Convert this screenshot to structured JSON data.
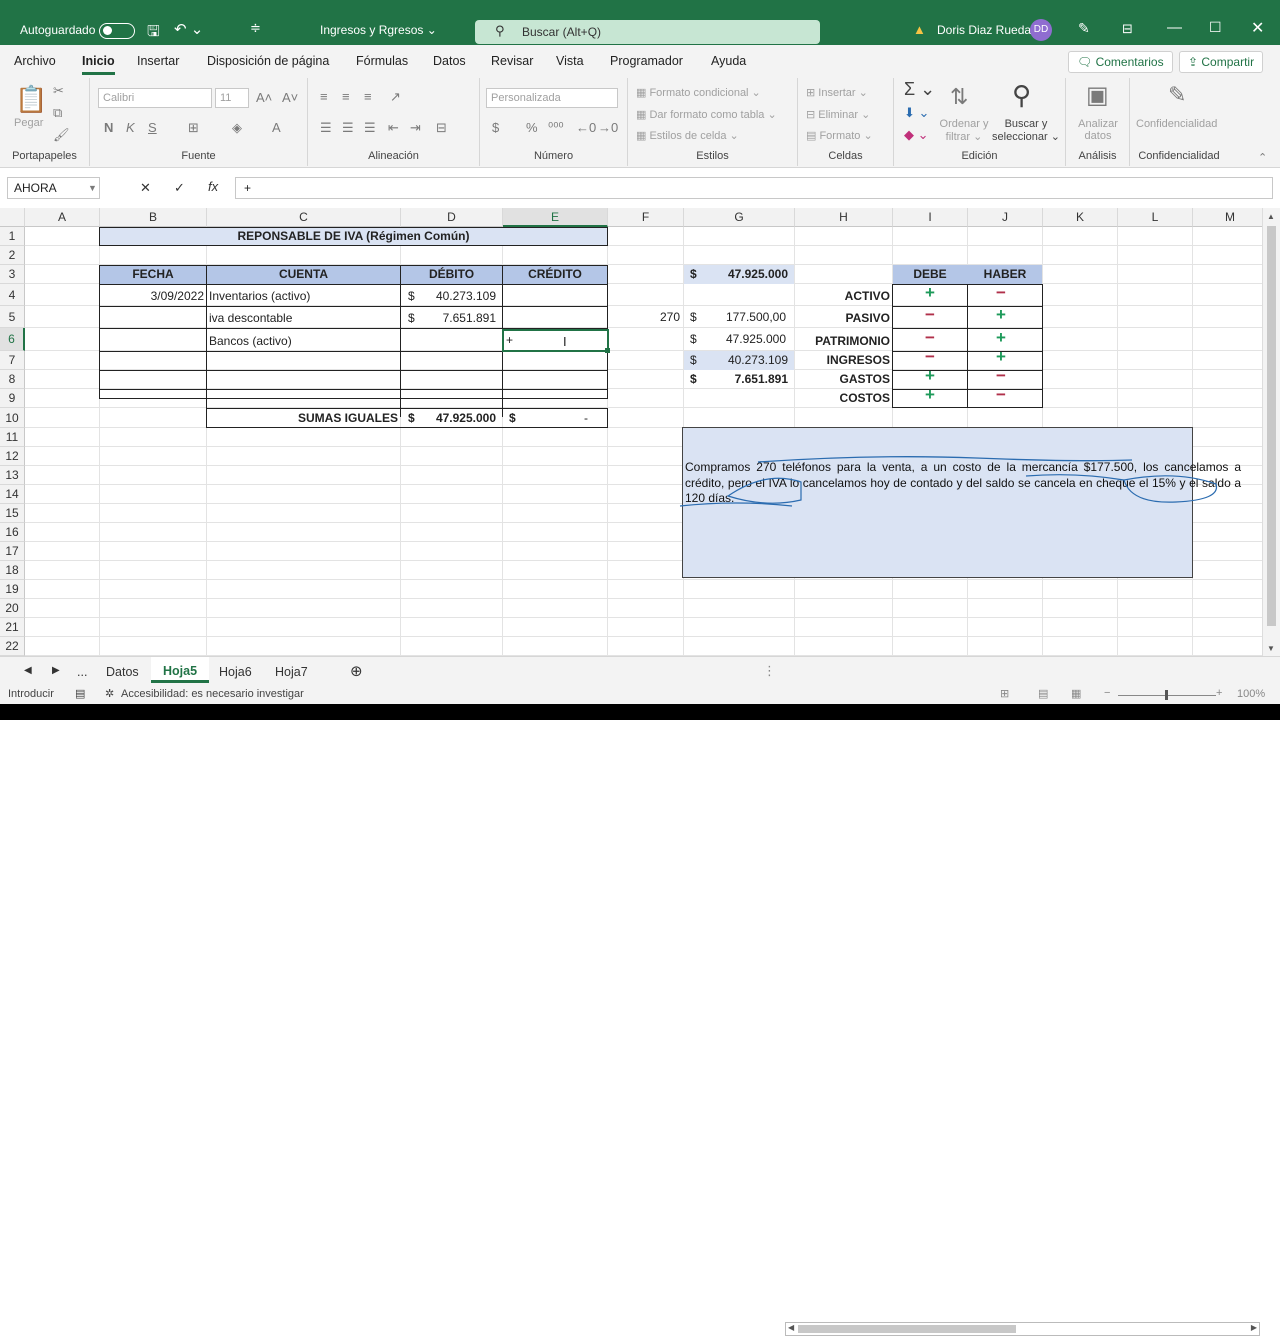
{
  "titlebar": {
    "autosave_label": "Autoguardado",
    "filename": "Ingresos y Rgresos ⌄",
    "search_placeholder": "Buscar (Alt+Q)",
    "user_name": "Doris Diaz Rueda",
    "user_initials": "DD"
  },
  "tabs": [
    "Archivo",
    "Inicio",
    "Insertar",
    "Disposición de página",
    "Fórmulas",
    "Datos",
    "Revisar",
    "Vista",
    "Programador",
    "Ayuda"
  ],
  "top_buttons": {
    "comments": "Comentarios",
    "share": "Compartir"
  },
  "ribbon": {
    "paste": "Pegar",
    "font_name": "Calibri",
    "font_size": "11",
    "number_format": "Personalizada",
    "cond_format": "Formato condicional ⌄",
    "table_format": "Dar formato como tabla ⌄",
    "cell_styles": "Estilos de celda ⌄",
    "insert": "Insertar ⌄",
    "delete": "Eliminar ⌄",
    "format": "Formato ⌄",
    "sort": "Ordenar y filtrar ⌄",
    "find": "Buscar y seleccionar ⌄",
    "analyze": "Analizar datos",
    "confidentiality": "Confidencialidad",
    "groups": [
      "Portapapeles",
      "Fuente",
      "Alineación",
      "Número",
      "Estilos",
      "Celdas",
      "Edición",
      "Análisis",
      "Confidencialidad"
    ]
  },
  "formula_bar": {
    "name_box": "AHORA",
    "content": "+"
  },
  "columns": [
    "A",
    "B",
    "C",
    "D",
    "E",
    "F",
    "G",
    "H",
    "I",
    "J",
    "K",
    "L",
    "M"
  ],
  "rows": [
    "1",
    "2",
    "3",
    "4",
    "5",
    "6",
    "7",
    "8",
    "9",
    "10",
    "11",
    "12",
    "13",
    "14",
    "15",
    "16",
    "17",
    "18",
    "19",
    "20",
    "21",
    "22"
  ],
  "sheet": {
    "title": "REPONSABLE DE IVA   (Régimen Común)",
    "headers": {
      "fecha": "FECHA",
      "cuenta": "CUENTA",
      "debito": "DÉBITO",
      "credito": "CRÉDITO"
    },
    "rows": [
      {
        "fecha": "3/09/2022",
        "cuenta": "Inventarios (activo)",
        "debito_sym": "$",
        "debito": "40.273.109"
      },
      {
        "fecha": "",
        "cuenta": "iva descontable",
        "debito_sym": "$",
        "debito": "7.651.891"
      },
      {
        "fecha": "",
        "cuenta": "Bancos (activo)",
        "editing": "+"
      }
    ],
    "totals": {
      "label": "SUMAS IGUALES",
      "sym": "$",
      "debito": "47.925.000",
      "credito": "-"
    },
    "side_calc": {
      "f5": "270",
      "g3": "47.925.000",
      "g5": "177.500,00",
      "g6": "47.925.000",
      "g7": "40.273.109",
      "g8": "7.651.891",
      "sym": "$"
    },
    "rules": {
      "debe": "DEBE",
      "haber": "HABER",
      "items": [
        {
          "label": "ACTIVO",
          "debe": "+",
          "haber": "−"
        },
        {
          "label": "PASIVO",
          "debe": "−",
          "haber": "+"
        },
        {
          "label": "PATRIMONIO",
          "debe": "−",
          "haber": "+"
        },
        {
          "label": "INGRESOS",
          "debe": "−",
          "haber": "+"
        },
        {
          "label": "GASTOS",
          "debe": "+",
          "haber": "−"
        },
        {
          "label": "COSTOS",
          "debe": "+",
          "haber": "−"
        }
      ]
    },
    "problem_text": "Compramos 270 teléfonos para la venta, a un costo de la mercancía $177.500, los cancelamos a crédito, pero el IVA lo cancelamos hoy de contado y del saldo se cancela en cheque el 15% y el saldo a 120 días."
  },
  "sheet_tabs": [
    "Datos",
    "Hoja5",
    "Hoja6",
    "Hoja7"
  ],
  "status": {
    "mode": "Introducir",
    "accessibility": "Accesibilidad: es necesario investigar",
    "zoom": "100%"
  },
  "colors": {
    "excel_green": "#217346",
    "header_blue": "#b4c6e7",
    "light_blue": "#dae3f3",
    "plus_green": "#1e9a5a",
    "minus_red": "#b0304a"
  }
}
